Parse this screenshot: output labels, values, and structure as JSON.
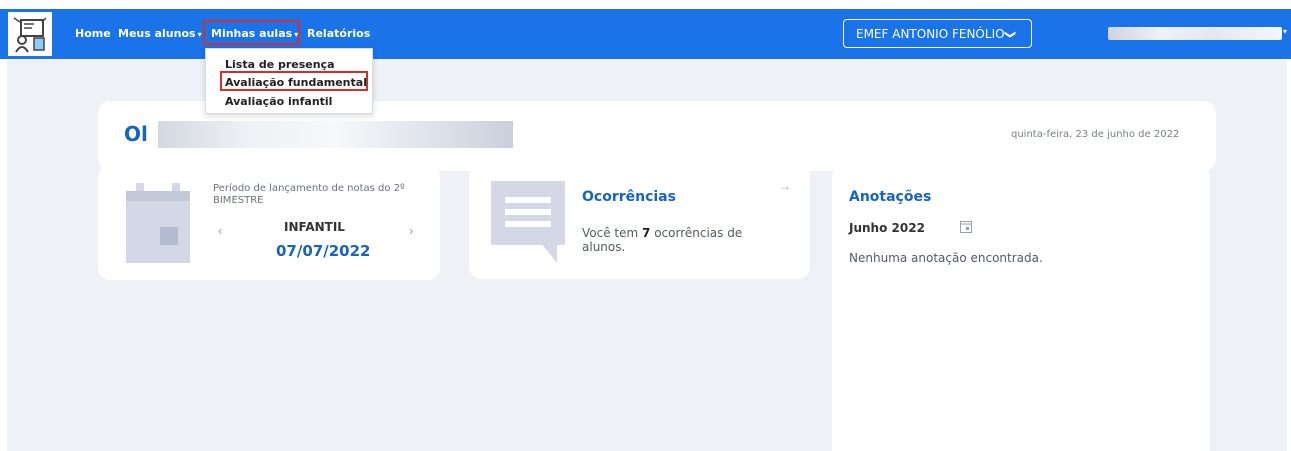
{
  "navbar": {
    "logo_icon": "school-board-icon",
    "items": [
      {
        "label": "Home"
      },
      {
        "label": "Meus alunos",
        "caret": "▾"
      },
      {
        "label": "Minhas aulas",
        "caret": "▾"
      },
      {
        "label": "Relatórios"
      }
    ],
    "school_select": {
      "value": "EMEF ANTONIO FENÓLIO",
      "chevron": "❯"
    },
    "user_caret": "▾",
    "accent_color": "#1a73e8"
  },
  "dropdown": {
    "items": [
      {
        "label": "Lista de presença"
      },
      {
        "label": "Avaliação fundamental"
      },
      {
        "label": "Avaliação infantil"
      }
    ],
    "highlighted_index": 1
  },
  "greeting": {
    "prefix": "Ol",
    "date": "quinta-feira, 23 de junho de 2022"
  },
  "period_card": {
    "icon": "calendar-icon",
    "description": "Período de lançamento de notas do 2º BIMESTRE",
    "level": "INFANTIL",
    "date": "07/07/2022",
    "prev": "‹",
    "next": "›"
  },
  "occurrences_card": {
    "icon": "message-icon",
    "title": "Ocorrências",
    "arrow": "→",
    "text_before": "Você tem ",
    "count": "7",
    "text_after": " ocorrências de alunos."
  },
  "notes_card": {
    "title": "Anotações",
    "month": "Junho 2022",
    "calendar_icon": "calendar-small-icon",
    "empty_message": "Nenhuma anotação encontrada."
  },
  "colors": {
    "primary_text": "#1565c0",
    "highlight_border": "#d32f2f",
    "page_background": "#eef1f6"
  }
}
